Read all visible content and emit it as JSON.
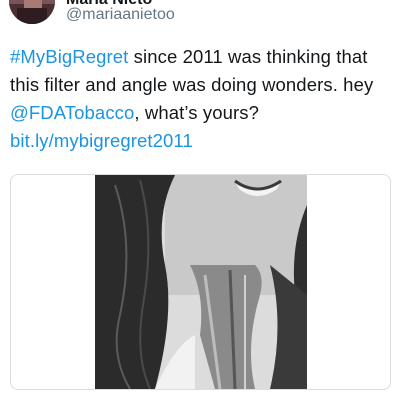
{
  "tweet": {
    "author": {
      "display_name": "Maria Nieto",
      "handle": "@mariaanietoo"
    },
    "text": {
      "hashtag": "#MyBigRegret",
      "part1": " since 2011 was thinking that this filter and angle was doing wonders. hey ",
      "mention": "@FDATobacco",
      "part2": ", what’s yours?",
      "link": "bit.ly/mybigregret2011"
    },
    "media": {
      "icon": "photo-image",
      "style": "black-and-white selfie"
    }
  },
  "colors": {
    "link": "#1b95e0",
    "text": "#14171a",
    "secondary": "#657786",
    "border": "#d9dee2"
  }
}
